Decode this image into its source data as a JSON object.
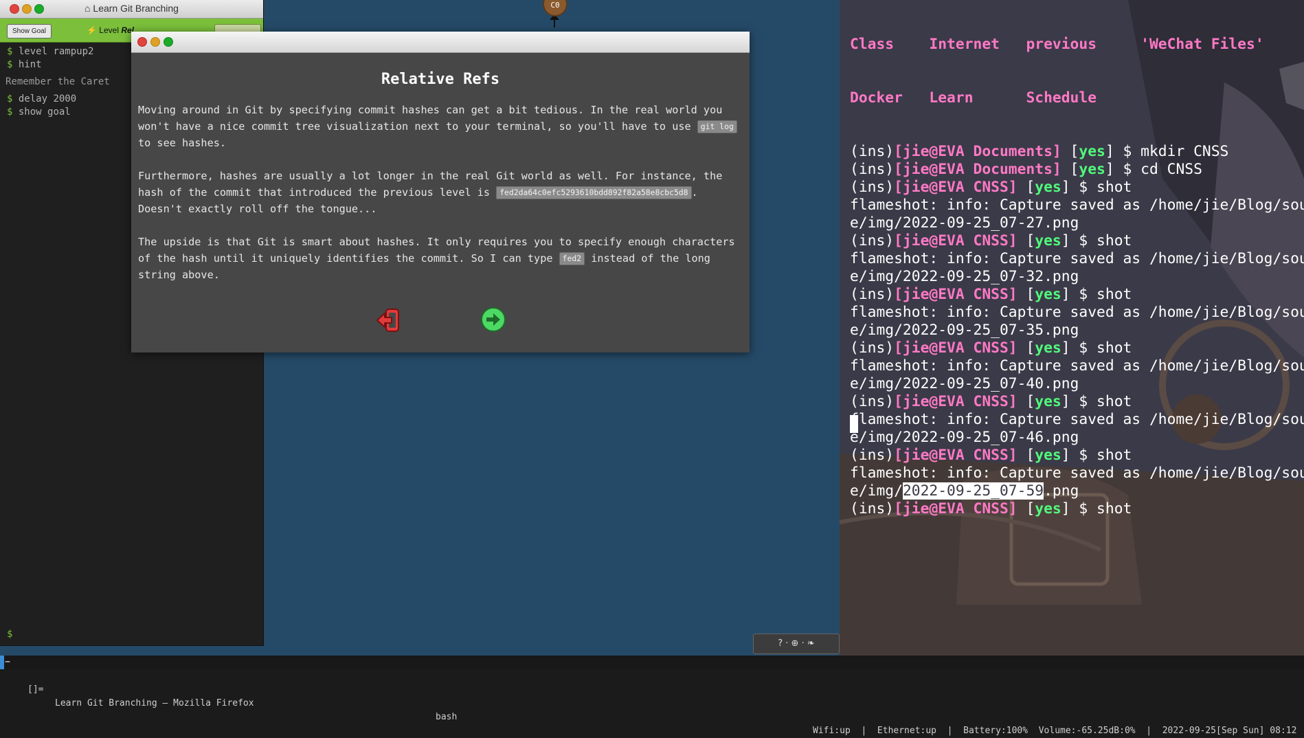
{
  "browser": {
    "terminal": {
      "title": "Learn Git Branching",
      "show_goal_label": "Show Goal",
      "level_prefix": "Level",
      "level_name": "Rel",
      "commands": [
        {
          "prompt": "$",
          "text": "level rampup2"
        },
        {
          "prompt": "$",
          "text": "hint"
        }
      ],
      "note": "Remember the Caret",
      "commands2": [
        {
          "prompt": "$",
          "text": "delay 2000"
        },
        {
          "prompt": "$",
          "text": "show goal"
        }
      ],
      "prompt": "$"
    },
    "commit_node": "C0",
    "help_box": "? · ⊕ · ❧",
    "modal": {
      "heading": "Relative Refs",
      "para1_a": "Moving around in Git by specifying commit hashes can get a bit tedious. In the real world you won't have a nice commit tree visualization next to your terminal, so you'll have to use ",
      "para1_code": "git log",
      "para1_b": " to see hashes.",
      "para2_a": "Furthermore, hashes are usually a lot longer in the real Git world as well. For instance, the hash of the commit that introduced the previous level is ",
      "para2_code": "fed2da64c0efc5293610bdd892f82a58e8cbc5d8",
      "para2_b": ". Doesn't exactly roll off the tongue...",
      "para3_a": "The upside is that Git is smart about hashes. It only requires you to specify enough characters of the hash until it uniquely identifies the commit. So I can type ",
      "para3_code": "fed2",
      "para3_b": " instead of the long string above."
    }
  },
  "bash": {
    "ls_row1": [
      "Class",
      "Internet",
      "previous",
      "'WeChat Files'"
    ],
    "ls_row2": [
      "Docker",
      "Learn",
      "Schedule"
    ],
    "lines": [
      {
        "type": "prompt",
        "env": "(ins)",
        "userhost": "[jie@EVA Documents]",
        "flag": "yes",
        "cmd": "$ mkdir CNSS"
      },
      {
        "type": "prompt",
        "env": "(ins)",
        "userhost": "[jie@EVA Documents]",
        "flag": "yes",
        "cmd": "$ cd CNSS"
      },
      {
        "type": "prompt",
        "env": "(ins)",
        "userhost": "[jie@EVA CNSS]",
        "flag": "yes",
        "cmd": "$ shot"
      },
      {
        "type": "out",
        "text": "flameshot: info: Capture saved as /home/jie/Blog/sourc"
      },
      {
        "type": "out",
        "text": "e/img/2022-09-25_07-27.png"
      },
      {
        "type": "prompt",
        "env": "(ins)",
        "userhost": "[jie@EVA CNSS]",
        "flag": "yes",
        "cmd": "$ shot"
      },
      {
        "type": "out",
        "text": "flameshot: info: Capture saved as /home/jie/Blog/sourc"
      },
      {
        "type": "out",
        "text": "e/img/2022-09-25_07-32.png"
      },
      {
        "type": "prompt",
        "env": "(ins)",
        "userhost": "[jie@EVA CNSS]",
        "flag": "yes",
        "cmd": "$ shot"
      },
      {
        "type": "out",
        "text": "flameshot: info: Capture saved as /home/jie/Blog/sourc"
      },
      {
        "type": "out",
        "text": "e/img/2022-09-25_07-35.png"
      },
      {
        "type": "prompt",
        "env": "(ins)",
        "userhost": "[jie@EVA CNSS]",
        "flag": "yes",
        "cmd": "$ shot"
      },
      {
        "type": "out",
        "text": "flameshot: info: Capture saved as /home/jie/Blog/sourc"
      },
      {
        "type": "out",
        "text": "e/img/2022-09-25_07-40.png"
      },
      {
        "type": "prompt",
        "env": "(ins)",
        "userhost": "[jie@EVA CNSS]",
        "flag": "yes",
        "cmd": "$ shot"
      },
      {
        "type": "out",
        "text": "flameshot: info: Capture saved as /home/jie/Blog/sourc"
      },
      {
        "type": "out",
        "text": "e/img/2022-09-25_07-46.png"
      },
      {
        "type": "prompt",
        "env": "(ins)",
        "userhost": "[jie@EVA CNSS]",
        "flag": "yes",
        "cmd": "$ shot"
      },
      {
        "type": "out",
        "text": "flameshot: info: Capture saved as /home/jie/Blog/sourc"
      },
      {
        "type": "out_hl",
        "pre": "e/img/",
        "hl": "2022-09-25_07-59",
        "post": ".png"
      },
      {
        "type": "prompt",
        "env": "(ins)",
        "userhost": "[jie@EVA CNSS]",
        "flag": "yes",
        "cmd": "$ shot"
      }
    ]
  },
  "statusbar": {
    "workspace": "−",
    "layout": "[]=",
    "window_title": "Learn Git Branching — Mozilla Firefox",
    "bash_label": "bash",
    "right": "Wifi:up  |  Ethernet:up  |  Battery:100%  Volume:-65.25dB:0%  |  2022-09-25[Sep Sun] 08:12"
  },
  "colors": {
    "accent_green": "#7bbf3b",
    "modal_bg": "#474747",
    "term_pink": "#ff79c6",
    "term_green": "#50fa7b",
    "browser_bg": "#254a68"
  }
}
